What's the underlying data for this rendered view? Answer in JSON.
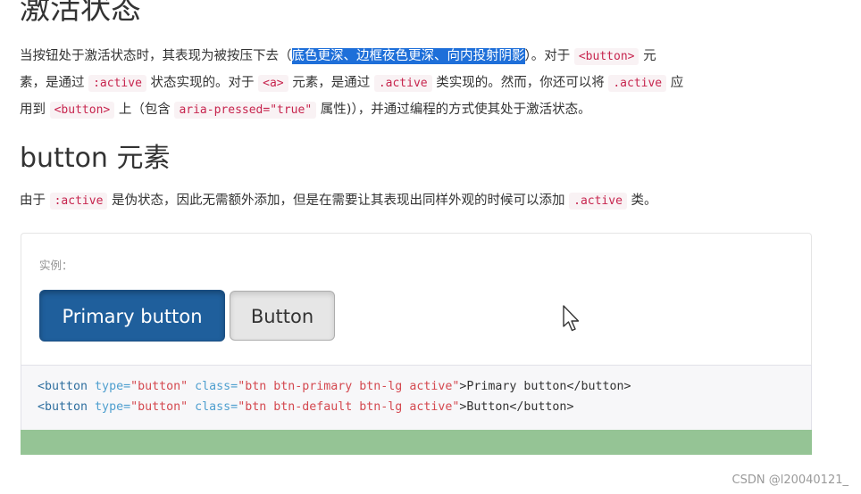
{
  "page_title": "激活状态",
  "intro": {
    "line1_prefix": "当按钮处于激活状态时，其表现为被按压下去（",
    "line1_highlight": "底色更深、边框夜色更深、向内投射阴影",
    "line1_mid": "）。对于",
    "line1_code": "<button>",
    "line1_suffix": "元",
    "line2_prefix": "素，是通过",
    "line2_code1": ":active",
    "line2_mid1": "状态实现的。对于",
    "line2_code2": "<a>",
    "line2_mid2": "元素，是通过",
    "line2_code3": ".active",
    "line2_mid3": "类实现的。然而，你还可以将",
    "line2_code4": ".active",
    "line2_suffix": "应",
    "line3_prefix": "用到",
    "line3_code1": "<button>",
    "line3_mid1": "上（包含",
    "line3_code2": "aria-pressed=\"true\"",
    "line3_suffix": "属性)），并通过编程的方式使其处于激活状态。"
  },
  "section_title": "button 元素",
  "section_text": {
    "prefix": "由于",
    "code1": ":active",
    "mid": "是伪状态，因此无需额外添加，但是在需要让其表现出同样外观的时候可以添加",
    "code2": ".active",
    "suffix": "类。"
  },
  "example": {
    "label": "实例：",
    "primary_button": "Primary button",
    "default_button": "Button"
  },
  "code_lines": [
    {
      "open": "<button",
      "a1": " type=",
      "v1": "\"button\"",
      "a2": " class=",
      "v2": "\"btn btn-primary btn-lg active\"",
      "text": ">Primary button</button>"
    },
    {
      "open": "<button",
      "a1": " type=",
      "v1": "\"button\"",
      "a2": " class=",
      "v2": "\"btn btn-default btn-lg active\"",
      "text": ">Button</button>"
    }
  ],
  "watermark": "CSDN @l20040121_",
  "colors": {
    "primary_button_bg": "#1f5f9c",
    "highlight_bg": "#1e6fd9",
    "code_text": "#c7254e",
    "green_bar": "#95c495"
  },
  "icons": {
    "cursor": "mouse-pointer-icon"
  }
}
